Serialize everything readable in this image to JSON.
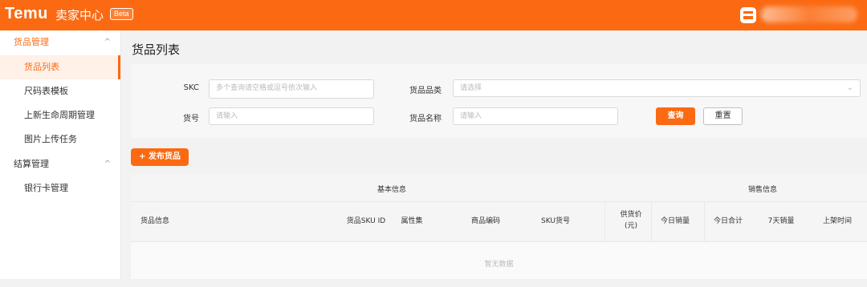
{
  "header": {
    "logo": "Temu",
    "app_name": "卖家中心",
    "badge": "Beta",
    "store_icon": "store-icon",
    "brand_color": "#fb6a12"
  },
  "sidebar": {
    "groups": [
      {
        "label": "货品管理",
        "chevron": "^",
        "items": [
          {
            "label": "货品列表",
            "active": true
          },
          {
            "label": "尺码表模板"
          },
          {
            "label": "上新生命周期管理"
          },
          {
            "label": "图片上传任务"
          }
        ]
      },
      {
        "label": "结算管理",
        "chevron": "^",
        "items": [
          {
            "label": "银行卡管理"
          }
        ]
      }
    ]
  },
  "page": {
    "title": "货品列表"
  },
  "filters": {
    "skc": {
      "label": "SKC",
      "placeholder": "多个查询请空格或逗号依次输入"
    },
    "category": {
      "label": "货品品类",
      "placeholder": "请选择",
      "arrow": "⌄"
    },
    "item_no": {
      "label": "货号",
      "placeholder": "请输入"
    },
    "name": {
      "label": "货品名称",
      "placeholder": "请输入"
    },
    "query_label": "查询",
    "reset_label": "重置"
  },
  "actions": {
    "publish_label": "+ 发布货品"
  },
  "table": {
    "groups": [
      "基本信息",
      "销售信息"
    ],
    "columns": [
      "货品信息",
      "货品SKU ID",
      "属性集",
      "商品编码",
      "SKU货号",
      "供货价\n(元)",
      "今日销量",
      "今日合计",
      "7天销量",
      "上架时间"
    ],
    "empty_text": "暂无数据"
  }
}
